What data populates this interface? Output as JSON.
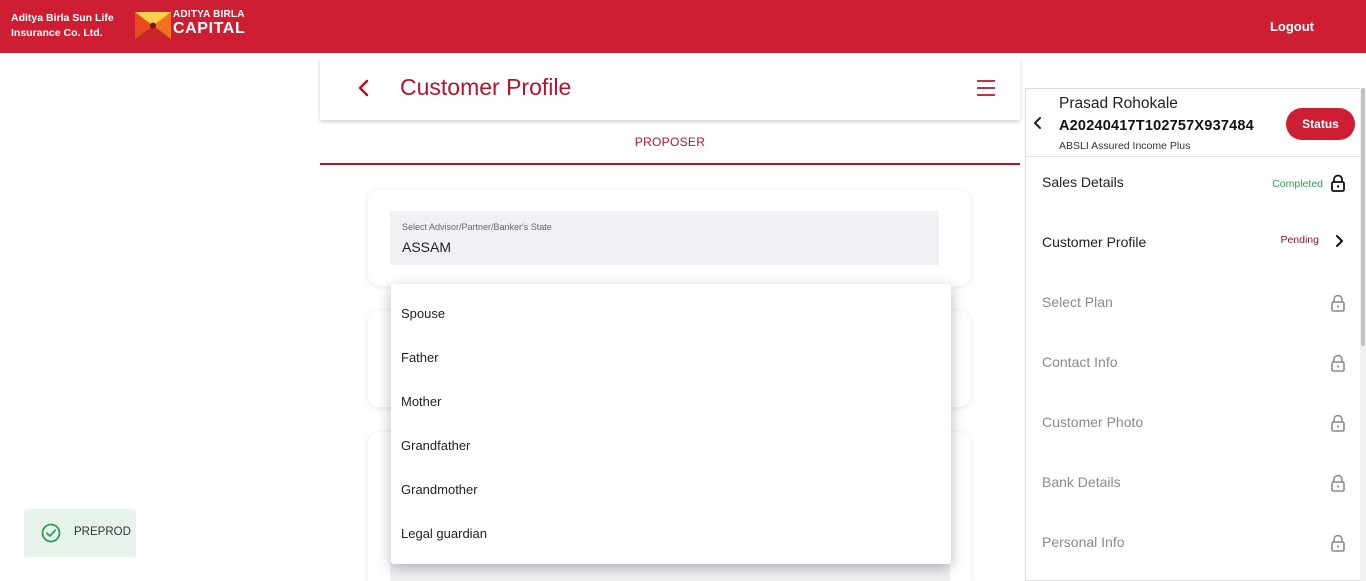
{
  "header": {
    "brand_line1": "Aditya Birla Sun Life",
    "brand_line2": "Insurance Co. Ltd.",
    "logo_line1": "ADITYA BIRLA",
    "logo_line2": "CAPITAL",
    "logout_label": "Logout",
    "brand_color": "#cd1e34"
  },
  "page": {
    "title": "Customer Profile",
    "back_icon": "chevron-left-icon",
    "menu_icon": "hamburger-menu-icon",
    "tab": "PROPOSER"
  },
  "form": {
    "state_label": "Select Advisor/Partner/Banker's State",
    "state_value": "ASSAM"
  },
  "dropdown": {
    "options": [
      "Spouse",
      "Father",
      "Mother",
      "Grandfather",
      "Grandmother",
      "Legal guardian"
    ]
  },
  "env_badge": {
    "label": "PREPROD",
    "icon": "check-circle-icon"
  },
  "side_panel": {
    "customer_name": "Prasad Rohokale",
    "application_id": "A20240417T102757X937484",
    "plan_name": "ABSLI Assured Income Plus",
    "status_button": "Status",
    "steps": [
      {
        "label": "Sales Details",
        "status": "Completed",
        "icon": "lock-icon",
        "state": "completed"
      },
      {
        "label": "Customer Profile",
        "status": "Pending",
        "icon": "chevron-right-icon",
        "state": "pending"
      },
      {
        "label": "Select Plan",
        "status": "",
        "icon": "lock-icon",
        "state": "locked"
      },
      {
        "label": "Contact Info",
        "status": "",
        "icon": "lock-icon",
        "state": "locked"
      },
      {
        "label": "Customer Photo",
        "status": "",
        "icon": "lock-icon",
        "state": "locked"
      },
      {
        "label": "Bank Details",
        "status": "",
        "icon": "lock-icon",
        "state": "locked"
      },
      {
        "label": "Personal Info",
        "status": "",
        "icon": "lock-icon",
        "state": "locked"
      }
    ]
  },
  "colors": {
    "accent": "#b2142b",
    "completed": "#2e9c55",
    "pending": "#8a1a2b",
    "locked_text": "#8a8a8a"
  }
}
